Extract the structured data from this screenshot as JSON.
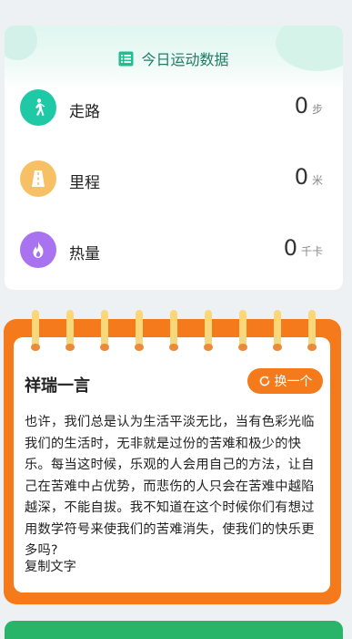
{
  "stats": {
    "title": "今日运动数据",
    "header_icon": "list-doc-icon",
    "items": [
      {
        "label": "走路",
        "value": "0",
        "unit": "步",
        "icon": "walking-icon",
        "color": "#1fc9a6"
      },
      {
        "label": "里程",
        "value": "0",
        "unit": "米",
        "icon": "road-icon",
        "color": "#f7c064"
      },
      {
        "label": "热量",
        "value": "0",
        "unit": "千卡",
        "icon": "flame-icon",
        "color": "#a872f0"
      }
    ]
  },
  "quote": {
    "title": "祥瑞一言",
    "swap_label": "换一个",
    "swap_icon": "refresh-icon",
    "text": "也许，我们总是认为生活平淡无比，当有色彩光临我们的生活时，无非就是过份的苦难和极少的快乐。每当这时候，乐观的人会用自己的方法，让自己在苦难中占优势，而悲伤的人只会在苦难中越陷越深，不能自拔。我不知道在这个时候你们有想过用数学符号来使我们的苦难消失，使我们的快乐更多吗?",
    "copy_label": "复制文字"
  },
  "colors": {
    "accent_green": "#1d7d63",
    "quote_orange": "#f57a1c",
    "ring_yellow": "#f9d77b"
  }
}
